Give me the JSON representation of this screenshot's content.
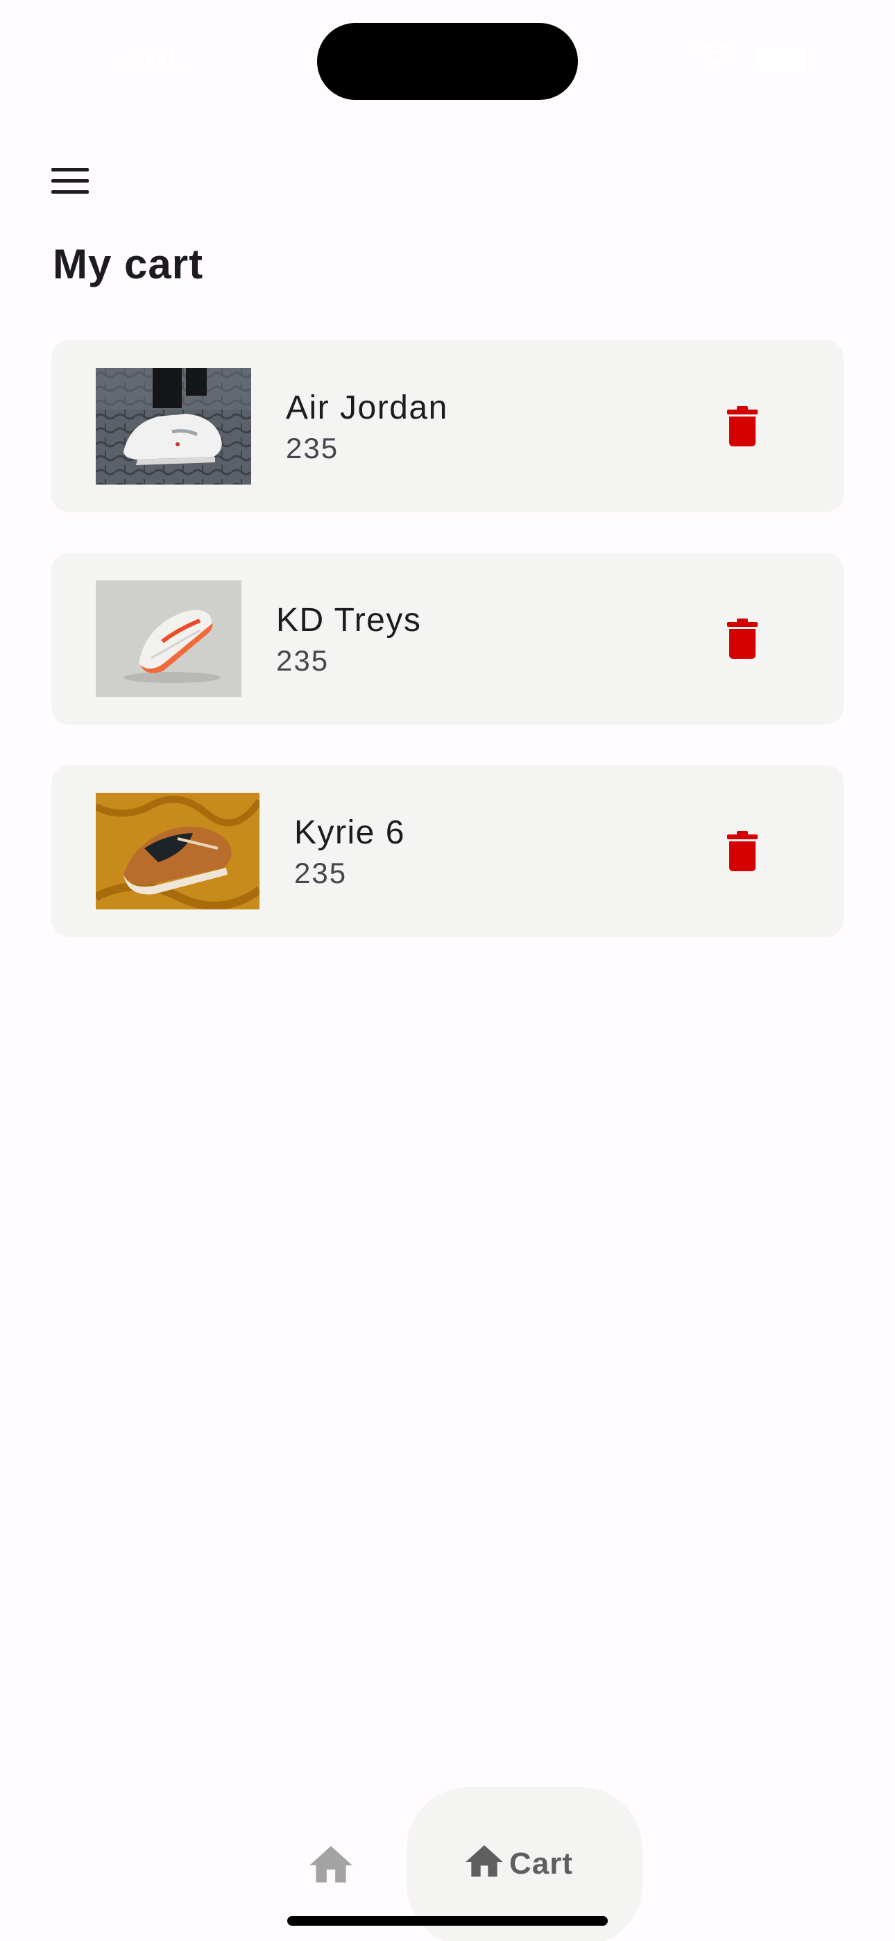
{
  "status_bar": {
    "time": "4:01"
  },
  "header": {
    "title": "My cart"
  },
  "cart": {
    "items": [
      {
        "name": "Air Jordan",
        "price": "235",
        "image": "white sneaker on cobblestone"
      },
      {
        "name": "KD Treys",
        "price": "235",
        "image": "white and orange sneaker on grey background"
      },
      {
        "name": "Kyrie 6",
        "price": "235",
        "image": "brown sneaker on mustard fabric"
      }
    ]
  },
  "bottom_nav": {
    "home_icon": "home-icon",
    "cart_label": "Cart",
    "cart_icon": "home-icon"
  },
  "colors": {
    "background": "#fffbfe",
    "card": "#f4f5f3",
    "delete_accent": "#d50000",
    "text_primary": "#1c1b1f",
    "text_secondary": "#49454f"
  }
}
